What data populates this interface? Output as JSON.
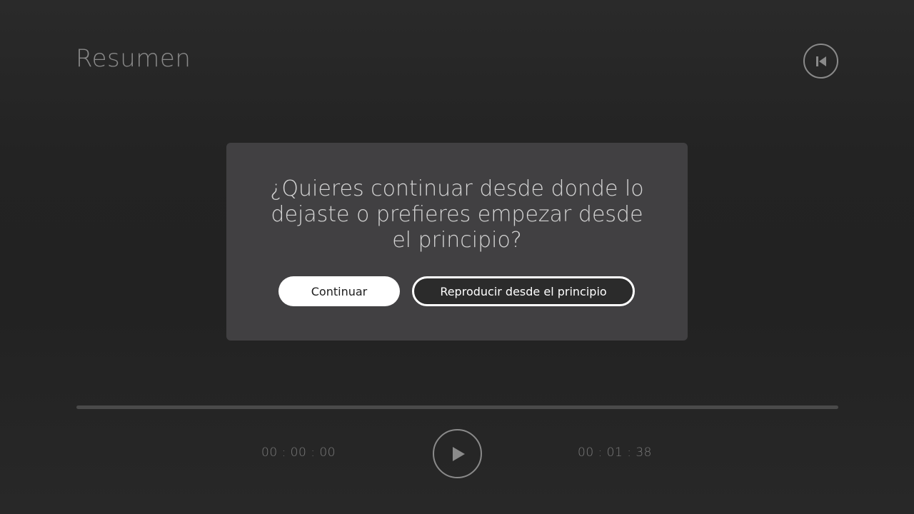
{
  "header": {
    "title": "Resumen",
    "restart_icon": "skip-to-start-icon"
  },
  "dialog": {
    "message": "¿Quieres continuar desde donde lo dejaste o prefieres empezar desde el principio?",
    "continue_label": "Continuar",
    "restart_label": "Reproducir desde el principio"
  },
  "player": {
    "current_time": "00 : 00 : 00",
    "total_time": "00 : 01 : 38",
    "progress": 0,
    "play_icon": "play-icon"
  },
  "colors": {
    "background": "#252525",
    "dialog": "#414042",
    "primary_button": "#ffffff",
    "muted_text": "#8a8a8a"
  }
}
